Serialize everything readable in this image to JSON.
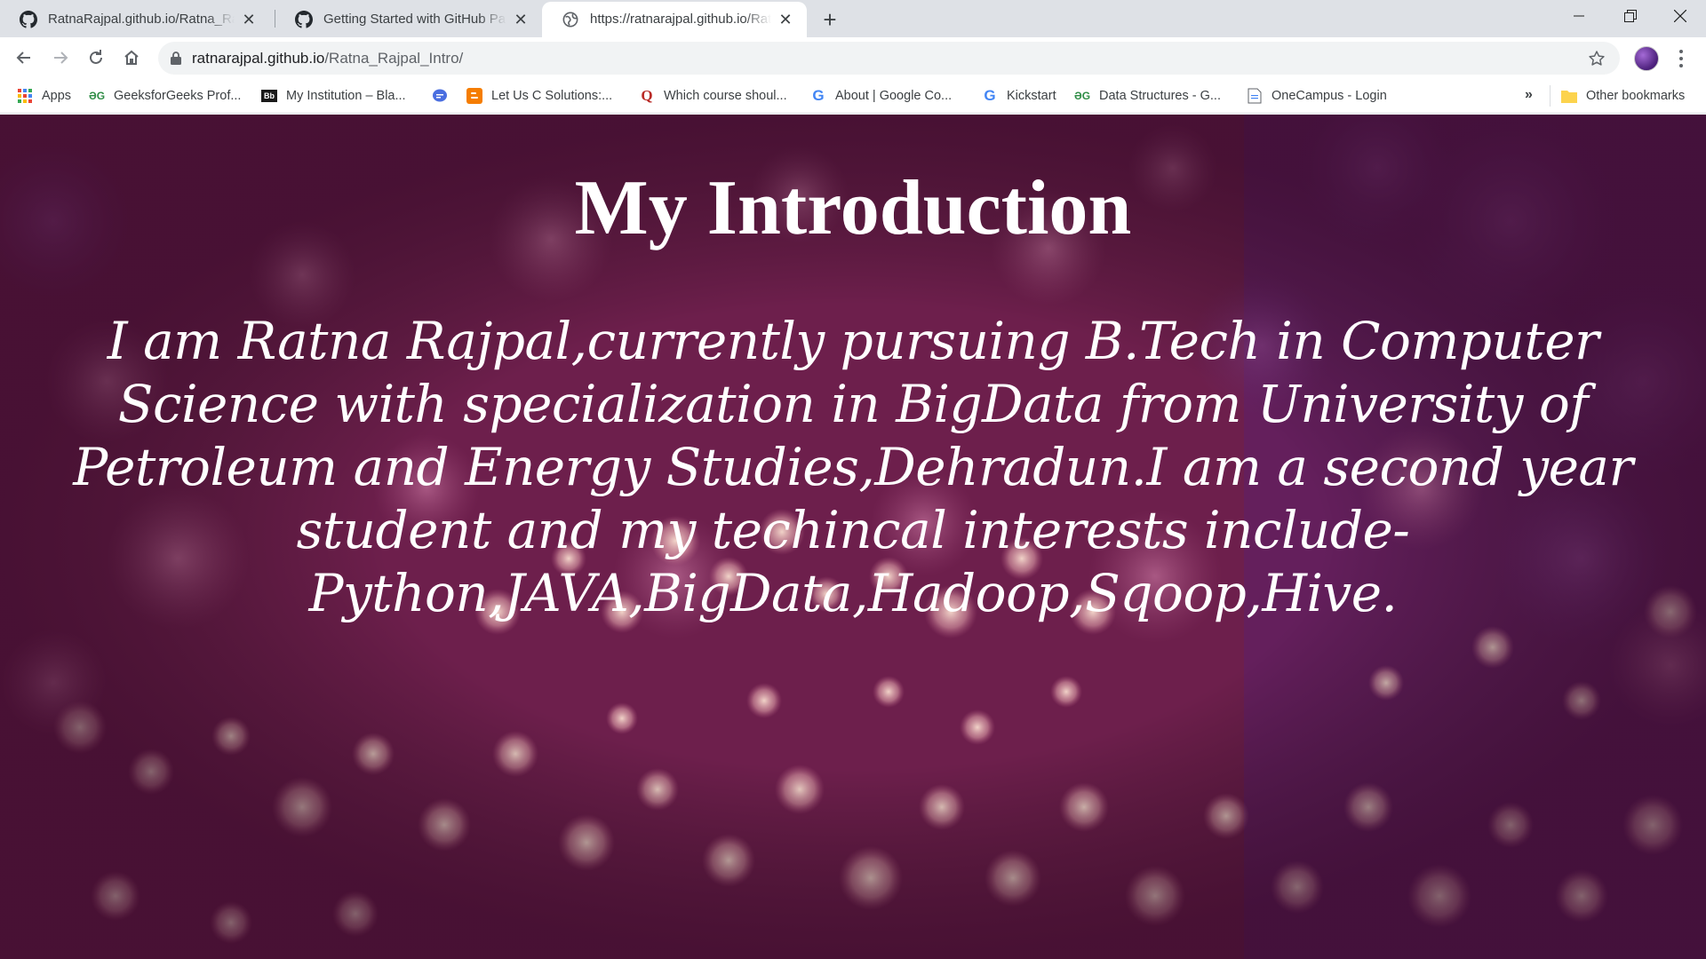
{
  "browser": {
    "tabs": [
      {
        "title": "RatnaRajpal.github.io/Ratna_Rajpal",
        "close": "✕",
        "favicon": "github-icon"
      },
      {
        "title": "Getting Started with GitHub Pages",
        "close": "✕",
        "favicon": "github-icon"
      },
      {
        "title": "https://ratnarajpal.github.io/Ratna_Rajpal_Intro/",
        "close": "✕",
        "favicon": "globe-icon"
      }
    ],
    "new_tab": "+",
    "address": {
      "domain": "ratnarajpal.github.io",
      "path": "/Ratna_Rajpal_Intro/"
    },
    "bookmarks": [
      {
        "label": "Apps",
        "icon": "apps-grid-icon"
      },
      {
        "label": "GeeksforGeeks Prof...",
        "icon": "gfg-icon"
      },
      {
        "label": "My Institution – Bla...",
        "icon": "blackboard-icon"
      },
      {
        "label": "",
        "icon": "chat-bubble-icon"
      },
      {
        "label": "Let Us C Solutions:...",
        "icon": "blogger-icon"
      },
      {
        "label": "Which course shoul...",
        "icon": "quora-icon"
      },
      {
        "label": "About | Google Co...",
        "icon": "google-icon"
      },
      {
        "label": "Kickstart",
        "icon": "google-icon"
      },
      {
        "label": "Data Structures - G...",
        "icon": "gfg-icon"
      },
      {
        "label": "OneCampus - Login",
        "icon": "document-icon"
      }
    ],
    "overflow": "»",
    "other_bookmarks": "Other bookmarks"
  },
  "page": {
    "title": "My Introduction",
    "intro": "I am Ratna Rajpal,currently pursuing B.Tech in Computer Science with specialization in BigData from University of Petroleum and Energy Studies,Dehradun.I am a second year student and my techincal interests include- Python,JAVA,BigData,Hadoop,Sqoop,Hive."
  },
  "colors": {
    "tab_strip": "#dee1e6",
    "omnibox": "#f1f3f4",
    "page_bg": "#6a1c46",
    "text": "#ffffff"
  }
}
